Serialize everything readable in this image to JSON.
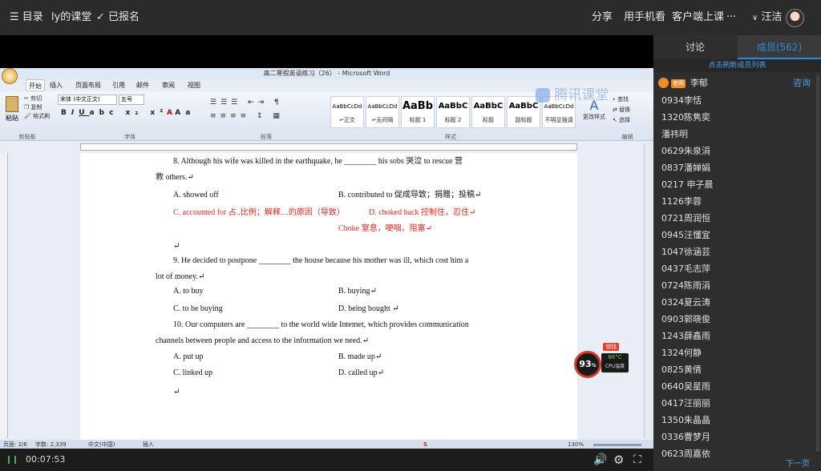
{
  "topbar": {
    "menu_label": "目录",
    "course_title": "ly的课堂",
    "enrolled_label": "已报名",
    "share_label": "分享",
    "phone_label": "用手机看",
    "client_label": "客户端上课",
    "more_label": "···",
    "user_name": "汪洁"
  },
  "word": {
    "window_title": "高二寒假英语练习（26） - Microsoft Word",
    "tabs": [
      "开始",
      "插入",
      "页面布局",
      "引用",
      "邮件",
      "审阅",
      "视图"
    ],
    "clipboard": {
      "paste": "粘贴",
      "cut": "剪切",
      "copy": "复制",
      "format_painter": "格式刷",
      "group": "剪贴板"
    },
    "font": {
      "name": "宋体 (中文正文)",
      "size": "五号",
      "group": "字体"
    },
    "paragraph_group": "段落",
    "styles_group": "样式",
    "editing_group": "编辑",
    "styles": [
      {
        "preview": "AaBbCcDd",
        "label": "↵正文"
      },
      {
        "preview": "AaBbCcDd",
        "label": "↵无间隔"
      },
      {
        "preview": "AaBb",
        "label": "标题 1"
      },
      {
        "preview": "AaBbC",
        "label": "标题 2"
      },
      {
        "preview": "AaBbC",
        "label": "标题"
      },
      {
        "preview": "AaBbC",
        "label": "副标题"
      },
      {
        "preview": "AaBbCcDd",
        "label": "不明显强调"
      }
    ],
    "change_styles": "更改样式",
    "find": "查找",
    "replace": "替换",
    "select": "选择",
    "watermark": "腾讯课堂",
    "doc_lines": [
      {
        "text": "8.   Although his wife was killed in the earthquake, he ________ his sobs 哭泣  to rescue  营",
        "red": false
      },
      {
        "text": "救 others.↵",
        "red": false
      },
      {
        "text": "A.  showed off",
        "red": false
      },
      {
        "text": "B.  contributed to  促成导致；捐赠；投稿↵",
        "red": false
      },
      {
        "text": "C.  accounted for  占..比例；解释…的原因（导致）",
        "red": true
      },
      {
        "text": "D.  choked back  控制住，忍住↵",
        "red": true
      },
      {
        "text": "Choke    窒息，哽咽，阻塞↵",
        "red": true
      },
      {
        "text": "↵",
        "red": false
      },
      {
        "text": "9. He decided to postpone ________ the house because his mother was ill, which cost him a",
        "red": false
      },
      {
        "text": "lot of money.↵",
        "red": false
      },
      {
        "text": "A.  to buy",
        "red": false
      },
      {
        "text": "B.  buying↵",
        "red": false
      },
      {
        "text": "C.  to be buying",
        "red": false
      },
      {
        "text": "D.  being bought ↵",
        "red": false
      },
      {
        "text": "10.   Our computers are ________ to the world wide Intemet, which provides communication",
        "red": false
      },
      {
        "text": "channels between people and access to the information we need.↵",
        "red": false
      },
      {
        "text": "A.  put up",
        "red": false
      },
      {
        "text": "B.  made up↵",
        "red": false
      },
      {
        "text": "C.  linked up",
        "red": false
      },
      {
        "text": "D.  called up↵",
        "red": false
      },
      {
        "text": "↵",
        "red": false
      }
    ],
    "status": {
      "page": "页面: 2/6",
      "words": "字数: 2,339",
      "language": "中文(中国)",
      "mode": "插入",
      "zoom": "130%"
    }
  },
  "cpu_widget": {
    "percent": "93",
    "percent_unit": "%",
    "badge": "领钱",
    "temp": "66°C",
    "label": "CPU温度"
  },
  "bottombar": {
    "time": "00:07:53"
  },
  "sidebar": {
    "tab_discuss": "讨论",
    "tab_members": "成员(562)",
    "refresh_label": "点击刷新成员列表",
    "teacher_badge": "老师",
    "teacher_name": "李郁",
    "consult_label": "咨询",
    "members": [
      "0934李恬",
      "1320陈隽奕",
      "潘祎明",
      "0629朱泉涓",
      "0837潘婵娟",
      "0217 申子晨",
      "1126李蓉",
      "0721周润恒",
      "0945汪懂宜",
      "1047徐涵芸",
      "0437毛志萍",
      "0724陈雨涓",
      "0324夏云涛",
      "0903郭晓俊",
      "1243薛鑫雨",
      "1324何静",
      "0825黄倩",
      "0640吴星雨",
      "0417汪丽丽",
      "1350朱晶晶",
      "0336曹梦月",
      "0623周嘉依"
    ],
    "next_page": "下一页"
  },
  "colors": {
    "accent": "#2f8bd8",
    "teacher_badge": "#f08c2a",
    "doc_red": "#e2231a"
  }
}
